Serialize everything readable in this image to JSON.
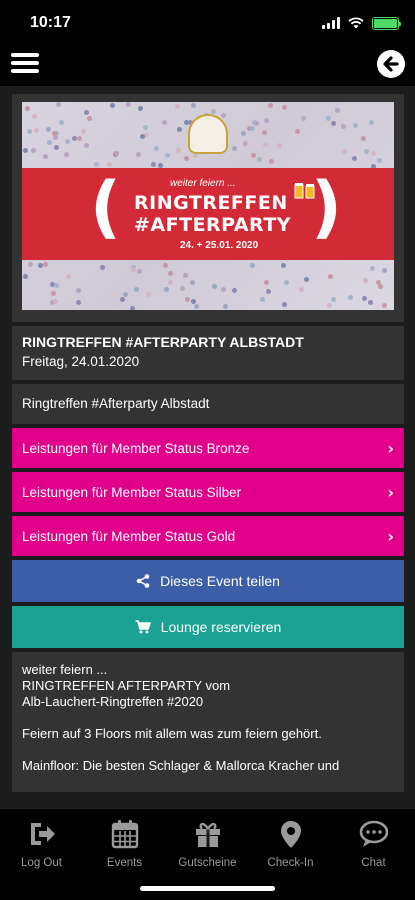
{
  "status_bar": {
    "time": "10:17"
  },
  "event": {
    "banner": {
      "kicker": "weiter feiern ...",
      "title_line1": "RINGTREFFEN",
      "title_line2": "#AFTERPARTY",
      "dates": "24. + 25.01. 2020"
    },
    "title": "RINGTREFFEN #AFTERPARTY ALBSTADT",
    "date": "Freitag, 24.01.2020",
    "subtitle": "Ringtreffen #Afterparty Albstadt"
  },
  "member_buttons": [
    {
      "label": "Leistungen für Member Status Bronze"
    },
    {
      "label": "Leistungen für Member Status Silber"
    },
    {
      "label": "Leistungen für Member Status Gold"
    }
  ],
  "share_button": {
    "label": "Dieses Event teilen"
  },
  "lounge_button": {
    "label": "Lounge reservieren"
  },
  "description": {
    "lines": [
      "weiter feiern ...",
      "RINGTREFFEN AFTERPARTY vom",
      "Alb-Lauchert-Ringtreffen #2020",
      "Feiern auf 3 Floors mit allem was zum feiern gehört.",
      "Mainfloor: Die besten Schlager & Mallorca Kracher und"
    ]
  },
  "tabbar": {
    "items": [
      {
        "label": "Log Out",
        "icon": "logout-icon"
      },
      {
        "label": "Events",
        "icon": "calendar-icon"
      },
      {
        "label": "Gutscheine",
        "icon": "gift-icon"
      },
      {
        "label": "Check-In",
        "icon": "map-pin-icon"
      },
      {
        "label": "Chat",
        "icon": "chat-icon"
      }
    ]
  },
  "colors": {
    "pink": "#e1008a",
    "blue": "#3c5ea8",
    "teal": "#1aa394",
    "card": "#333333"
  }
}
